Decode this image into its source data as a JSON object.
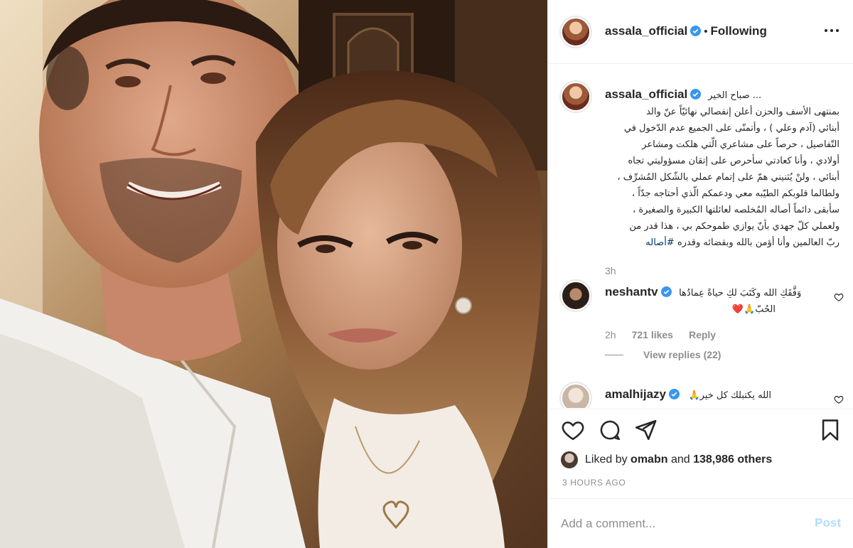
{
  "post": {
    "username": "assala_official",
    "follow_status": "Following",
    "caption_lines": [
      "صباح الخير ...",
      "بمنتهى الأسف والحزن أعلن إنفصالي نهائيّاً عنّ والد",
      "أبنائي (آدم وعلي ) ، وأتمنّى على الجميع عدم الدّخول في",
      "التّفاصيل ، حرصاً على مشاعري الّتي هلكت ومشاعر",
      "أولادي ، وأنا كعادتي سأحرص على إتقان مسؤوليتي تجاه",
      "أبنائي ، ولنْ يُثنيني همّ على إتمام عملي بالشّكل المُشرِّف ،",
      "ولطالما قلوبكم الطيّبه معي ودعمكم الّذي أحتاجه جدّاً ،",
      "سأبقى دائماً أصاله المُخلصه لعائلتها الكبيرة والصغيرة ،",
      "ولعملي كلّ جهدي بأنّ يوازي طموحكم بي ، هذا قدر من",
      "ربّ العالمين وأنا أؤمن بالله وبقضائه وقدره"
    ],
    "hashtag": "#أصاله",
    "caption_time": "3h"
  },
  "comments": [
    {
      "username": "neshantv",
      "text_line1": "وَفَّقَكِ الله وكَتَبَ لكِ حياةً عِمادُها",
      "text_line2": "الحُبّ🙏❤️",
      "time": "2h",
      "likes": "721 likes",
      "reply": "Reply",
      "view_replies": "View replies (22)"
    },
    {
      "username": "amalhijazy",
      "text": "🙏الله يكتبلك كل خير"
    }
  ],
  "likes": {
    "prefix": "Liked by",
    "user": "omabn",
    "middle": "and",
    "others": "138,986 others"
  },
  "time_ago": "3 HOURS AGO",
  "add_comment": {
    "placeholder": "Add a comment...",
    "post_label": "Post"
  },
  "colors": {
    "verified": "#3897f0",
    "link": "#00376b",
    "muted": "#8e8e8e",
    "post_disabled": "#b3dbff"
  },
  "icons": [
    "more-icon",
    "verified-icon",
    "heart-icon",
    "comment-icon",
    "share-icon",
    "bookmark-icon"
  ]
}
